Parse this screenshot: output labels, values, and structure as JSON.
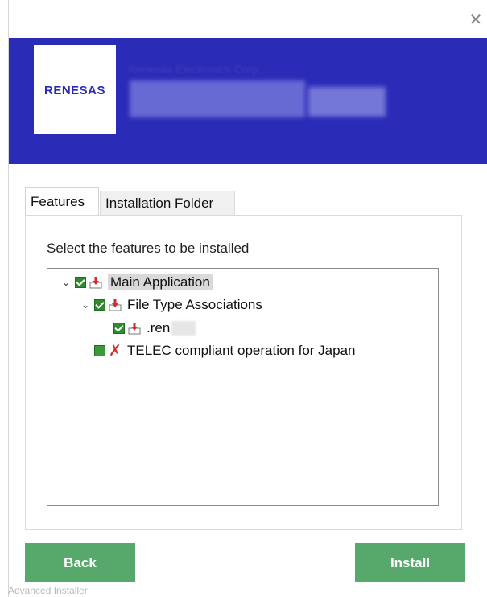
{
  "window": {
    "close_glyph": "✕"
  },
  "banner": {
    "logo_text": "RENESAS",
    "company": "Renesas Electronics Corp.",
    "bg_color": "#2a2bb7"
  },
  "tabs": [
    {
      "label": "Features",
      "active": true
    },
    {
      "label": "Installation Folder",
      "active": false
    }
  ],
  "panel": {
    "label": "Select the features to be installed"
  },
  "tree": {
    "items": [
      {
        "label": "Main Application",
        "expanded": true,
        "state": "checked",
        "icon": "install-icon"
      },
      {
        "label": "File Type Associations",
        "expanded": true,
        "state": "checked",
        "icon": "install-icon"
      },
      {
        "label": ".ren",
        "state": "checked",
        "icon": "install-icon"
      },
      {
        "label": "TELEC compliant operation for Japan",
        "state": "unchecked",
        "icon": "not-installed-x-icon"
      }
    ]
  },
  "buttons": {
    "back": "Back",
    "install": "Install",
    "color": "#56a86b"
  },
  "footer": {
    "brand": "Advanced Installer"
  }
}
